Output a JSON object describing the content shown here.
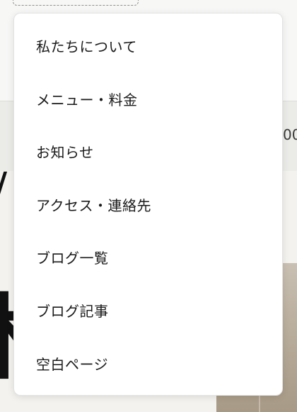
{
  "background": {
    "band_edge_text": "00"
  },
  "menu": {
    "items": [
      {
        "label": "私たちについて"
      },
      {
        "label": "メニュー・料金"
      },
      {
        "label": "お知らせ"
      },
      {
        "label": "アクセス・連絡先"
      },
      {
        "label": "ブログ一覧"
      },
      {
        "label": "ブログ記事"
      },
      {
        "label": "空白ページ"
      }
    ]
  }
}
